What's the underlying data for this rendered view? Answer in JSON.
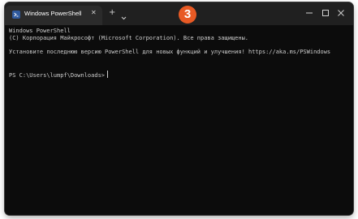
{
  "tab": {
    "title": "Windows PowerShell",
    "close_glyph": "✕",
    "icon": "powershell-icon"
  },
  "titlebar": {
    "new_tab_glyph": "+",
    "dropdown_icon": "chevron-down-icon",
    "minimize_icon": "minimize-icon",
    "maximize_icon": "maximize-icon",
    "close_icon": "close-icon"
  },
  "badge": {
    "number": "3",
    "color": "#e85a24"
  },
  "console": {
    "line1": "Windows PowerShell",
    "line2": "(С) Корпорация Майкрософт (Microsoft Corporation). Все права защищены.",
    "line3": "Установите последнюю версию PowerShell для новых функций и улучшения! https://aka.ms/PSWindows",
    "prompt": "PS C:\\Users\\lumpf\\Downloads>"
  },
  "colors": {
    "console_bg": "#0c0c0c",
    "titlebar_bg": "#202020",
    "tab_bg": "#2b2b2b",
    "text": "#cccccc"
  }
}
